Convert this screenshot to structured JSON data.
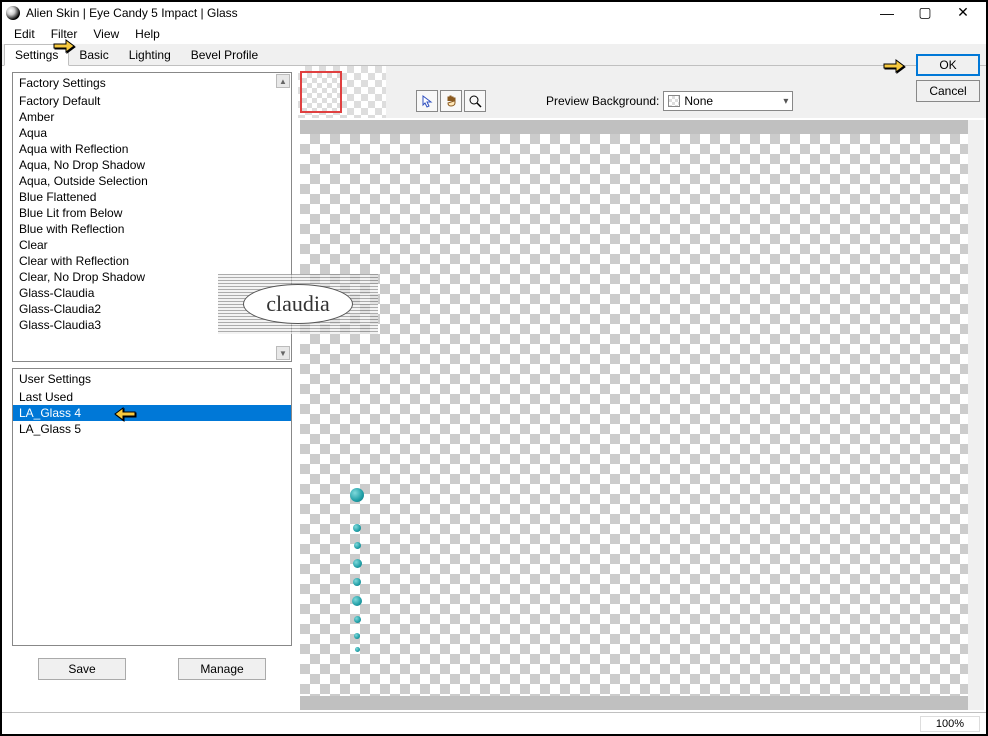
{
  "title": "Alien Skin | Eye Candy 5 Impact | Glass",
  "window_controls": {
    "min": "—",
    "max": "▢",
    "close": "✕"
  },
  "menu": [
    "Edit",
    "Filter",
    "View",
    "Help"
  ],
  "tabs": [
    "Settings",
    "Basic",
    "Lighting",
    "Bevel Profile"
  ],
  "active_tab": 0,
  "factory": {
    "header": "Factory Settings",
    "items": [
      "Factory Default",
      "Amber",
      "Aqua",
      "Aqua with Reflection",
      "Aqua, No Drop Shadow",
      "Aqua, Outside Selection",
      "Blue Flattened",
      "Blue Lit from Below",
      "Blue with Reflection",
      "Clear",
      "Clear with Reflection",
      "Clear, No Drop Shadow",
      "Glass-Claudia",
      "Glass-Claudia2",
      "Glass-Claudia3"
    ]
  },
  "user": {
    "header": "User Settings",
    "items": [
      "Last Used",
      "LA_Glass 4",
      "LA_Glass 5"
    ],
    "selected_index": 1
  },
  "buttons": {
    "save": "Save",
    "manage": "Manage",
    "ok": "OK",
    "cancel": "Cancel"
  },
  "preview_bg": {
    "label": "Preview Background:",
    "value": "None"
  },
  "zoom": "100%",
  "watermark": "claudia"
}
